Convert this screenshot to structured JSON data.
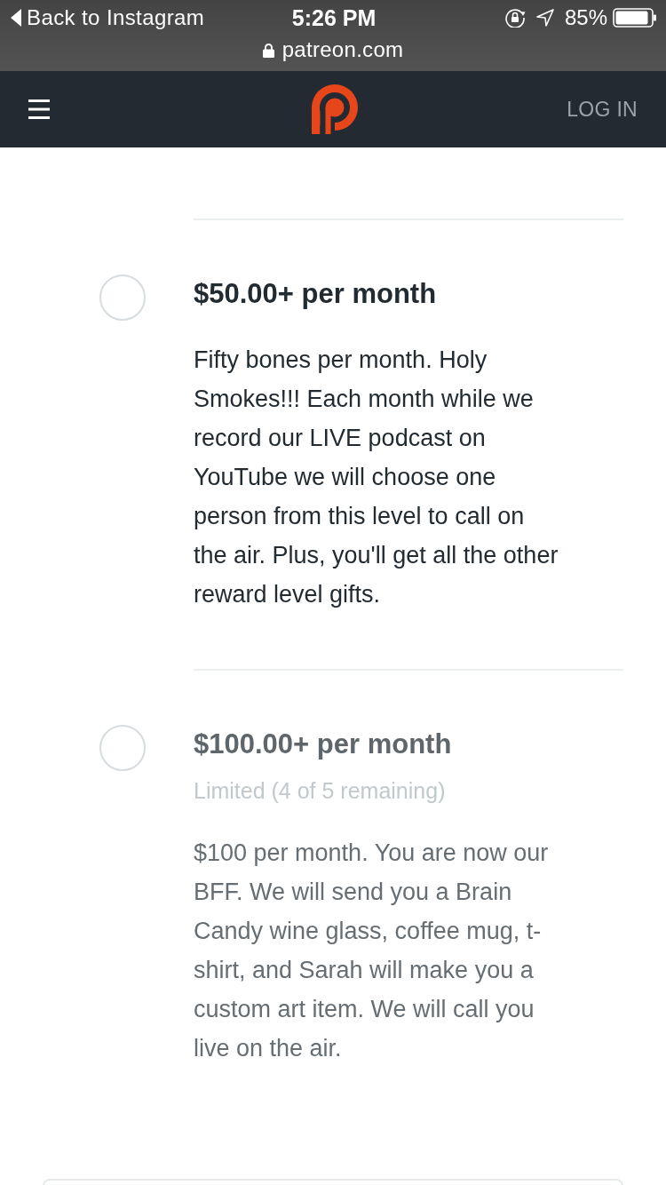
{
  "status_bar": {
    "back_label": "Back to Instagram",
    "time": "5:26 PM",
    "battery": "85%",
    "url": "patreon.com"
  },
  "nav": {
    "login": "LOG IN"
  },
  "tiers": [
    {
      "selected": false,
      "disabled": false,
      "title": "$50.00+ per month",
      "description": "Fifty bones per month. Holy Smokes!!! Each month while we record our LIVE podcast on YouTube we will choose one person from this level to call on the air. Plus, you'll get all the other reward level gifts."
    },
    {
      "selected": false,
      "disabled": true,
      "title": "$100.00+ per month",
      "limit": "Limited (4 of 5 remaining)",
      "description": "$100 per month. You are now our BFF. We will send you a Brain Candy wine glass, coffee mug, t-shirt, and Sarah will make you a custom art item. We will call you live on the air."
    }
  ]
}
